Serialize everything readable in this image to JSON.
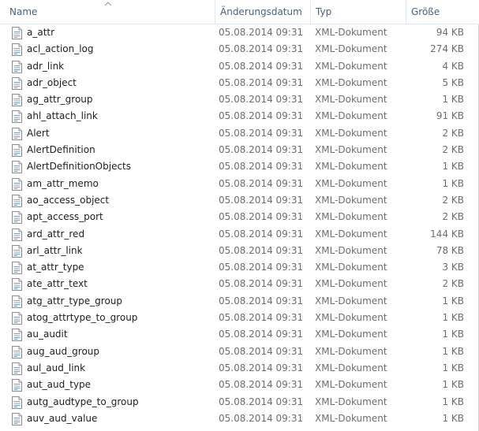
{
  "columns": {
    "name": "Name",
    "date": "Änderungsdatum",
    "type": "Typ",
    "size": "Größe"
  },
  "sort": {
    "column": "name",
    "icon": "sort-ascending-icon"
  },
  "file_icon": "xml-document-icon",
  "files": [
    {
      "name": "a_attr",
      "date": "05.08.2014 09:31",
      "type": "XML-Dokument",
      "size": "94 KB"
    },
    {
      "name": "acl_action_log",
      "date": "05.08.2014 09:31",
      "type": "XML-Dokument",
      "size": "274 KB"
    },
    {
      "name": "adr_link",
      "date": "05.08.2014 09:31",
      "type": "XML-Dokument",
      "size": "4 KB"
    },
    {
      "name": "adr_object",
      "date": "05.08.2014 09:31",
      "type": "XML-Dokument",
      "size": "5 KB"
    },
    {
      "name": "ag_attr_group",
      "date": "05.08.2014 09:31",
      "type": "XML-Dokument",
      "size": "1 KB"
    },
    {
      "name": "ahl_attach_link",
      "date": "05.08.2014 09:31",
      "type": "XML-Dokument",
      "size": "91 KB"
    },
    {
      "name": "Alert",
      "date": "05.08.2014 09:31",
      "type": "XML-Dokument",
      "size": "2 KB"
    },
    {
      "name": "AlertDefinition",
      "date": "05.08.2014 09:31",
      "type": "XML-Dokument",
      "size": "2 KB"
    },
    {
      "name": "AlertDefinitionObjects",
      "date": "05.08.2014 09:31",
      "type": "XML-Dokument",
      "size": "1 KB"
    },
    {
      "name": "am_attr_memo",
      "date": "05.08.2014 09:31",
      "type": "XML-Dokument",
      "size": "1 KB"
    },
    {
      "name": "ao_access_object",
      "date": "05.08.2014 09:31",
      "type": "XML-Dokument",
      "size": "2 KB"
    },
    {
      "name": "apt_access_port",
      "date": "05.08.2014 09:31",
      "type": "XML-Dokument",
      "size": "2 KB"
    },
    {
      "name": "ard_attr_red",
      "date": "05.08.2014 09:31",
      "type": "XML-Dokument",
      "size": "144 KB"
    },
    {
      "name": "arl_attr_link",
      "date": "05.08.2014 09:31",
      "type": "XML-Dokument",
      "size": "78 KB"
    },
    {
      "name": "at_attr_type",
      "date": "05.08.2014 09:31",
      "type": "XML-Dokument",
      "size": "3 KB"
    },
    {
      "name": "ate_attr_text",
      "date": "05.08.2014 09:31",
      "type": "XML-Dokument",
      "size": "2 KB"
    },
    {
      "name": "atg_attr_type_group",
      "date": "05.08.2014 09:31",
      "type": "XML-Dokument",
      "size": "1 KB"
    },
    {
      "name": "atog_attrtype_to_group",
      "date": "05.08.2014 09:31",
      "type": "XML-Dokument",
      "size": "1 KB"
    },
    {
      "name": "au_audit",
      "date": "05.08.2014 09:31",
      "type": "XML-Dokument",
      "size": "1 KB"
    },
    {
      "name": "aug_aud_group",
      "date": "05.08.2014 09:31",
      "type": "XML-Dokument",
      "size": "1 KB"
    },
    {
      "name": "aul_aud_link",
      "date": "05.08.2014 09:31",
      "type": "XML-Dokument",
      "size": "1 KB"
    },
    {
      "name": "aut_aud_type",
      "date": "05.08.2014 09:31",
      "type": "XML-Dokument",
      "size": "1 KB"
    },
    {
      "name": "autg_audtype_to_group",
      "date": "05.08.2014 09:31",
      "type": "XML-Dokument",
      "size": "1 KB"
    },
    {
      "name": "auv_aud_value",
      "date": "05.08.2014 09:31",
      "type": "XML-Dokument",
      "size": "1 KB"
    }
  ]
}
